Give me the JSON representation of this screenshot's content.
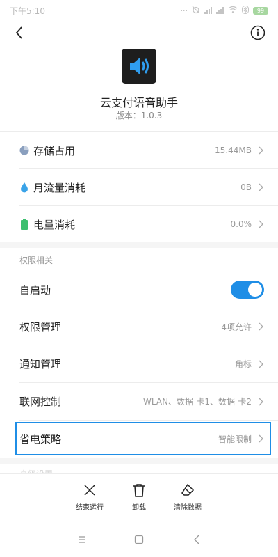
{
  "status_bar": {
    "time": "下午5:10",
    "battery": "99"
  },
  "app": {
    "name": "云支付语音助手",
    "version": "版本：1.0.3"
  },
  "usage": [
    {
      "label": "存储占用",
      "value": "15.44MB",
      "icon": "pie-chart-icon",
      "icon_color": "#8a9fbe"
    },
    {
      "label": "月流量消耗",
      "value": "0B",
      "icon": "water-drop-icon",
      "icon_color": "#3aa3e8"
    },
    {
      "label": "电量消耗",
      "value": "0.0%",
      "icon": "battery-icon",
      "icon_color": "#3cbf6e"
    }
  ],
  "permissions_section": {
    "title": "权限相关",
    "autostart": {
      "label": "自启动",
      "enabled": true
    },
    "items": [
      {
        "label": "权限管理",
        "value": "4项允许"
      },
      {
        "label": "通知管理",
        "value": "角标"
      },
      {
        "label": "联网控制",
        "value": "WLAN、数据-卡1、数据-卡2"
      },
      {
        "label": "省电策略",
        "value": "智能限制"
      }
    ]
  },
  "next_section": {
    "title": "高级设置"
  },
  "actions": [
    {
      "label": "结束运行",
      "icon": "close-icon"
    },
    {
      "label": "卸载",
      "icon": "trash-icon"
    },
    {
      "label": "清除数据",
      "icon": "eraser-icon"
    }
  ],
  "colors": {
    "accent": "#1f8ee6",
    "divider": "#ececec",
    "section_bg": "#f5f5f5"
  }
}
